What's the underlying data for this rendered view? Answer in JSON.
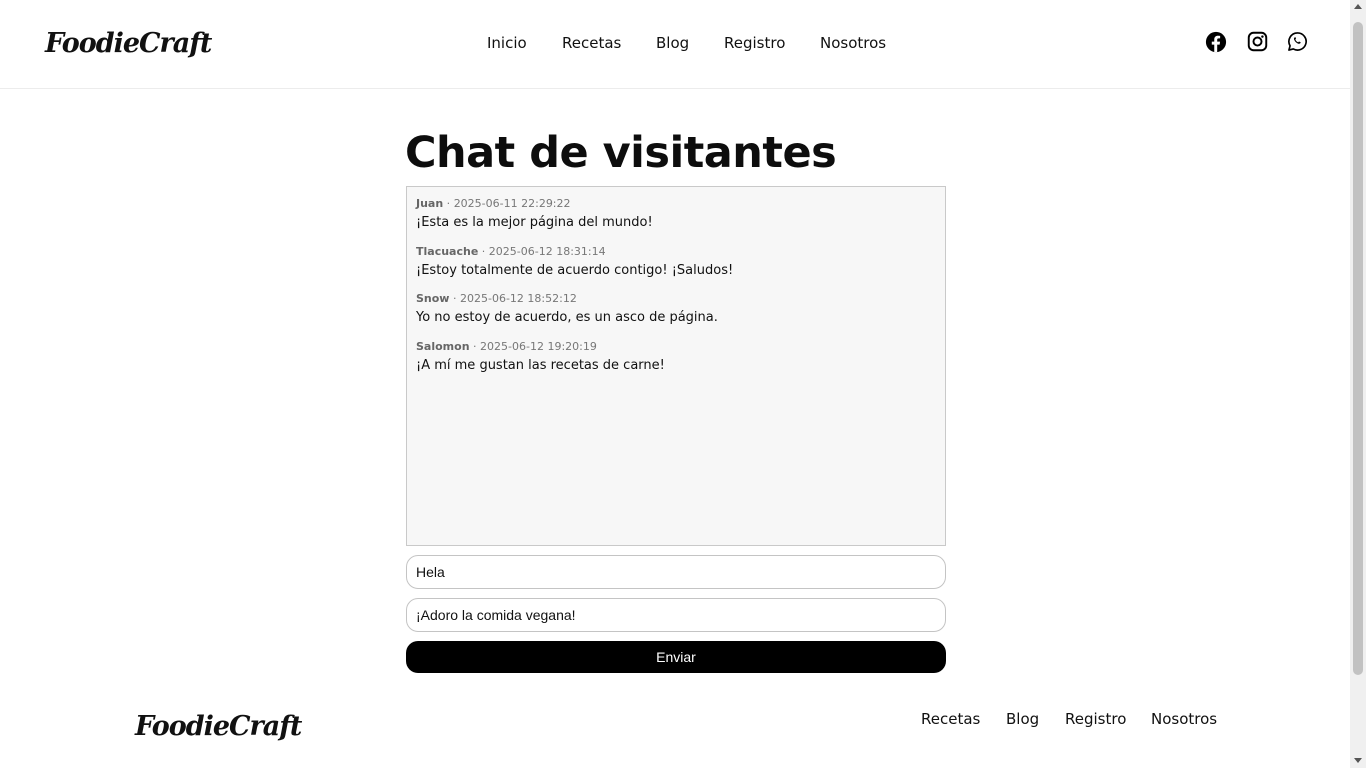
{
  "header": {
    "logo": "FoodieCraft",
    "nav": [
      "Inicio",
      "Recetas",
      "Blog",
      "Registro",
      "Nosotros"
    ],
    "social": [
      "facebook-icon",
      "instagram-icon",
      "whatsapp-icon"
    ]
  },
  "main": {
    "title": "Chat de visitantes",
    "messages": [
      {
        "author": "Juan",
        "time": "2025-06-11 22:29:22",
        "text": "¡Esta es la mejor página del mundo!"
      },
      {
        "author": "Tlacuache",
        "time": "2025-06-12 18:31:14",
        "text": "¡Estoy totalmente de acuerdo contigo! ¡Saludos!"
      },
      {
        "author": "Snow",
        "time": "2025-06-12 18:52:12",
        "text": "Yo no estoy de acuerdo, es un asco de página."
      },
      {
        "author": "Salomon",
        "time": "2025-06-12 19:20:19",
        "text": "¡A mí me gustan las recetas de carne!"
      }
    ],
    "meta_separator": " · ",
    "name_value": "Hela",
    "message_value": "¡Adoro la comida vegana!",
    "send_label": "Enviar"
  },
  "footer": {
    "logo": "FoodieCraft",
    "nav": [
      "Recetas",
      "Blog",
      "Registro",
      "Nosotros"
    ]
  },
  "colors": {
    "text": "#111111",
    "chat_bg": "#f7f7f7",
    "button_bg": "#000000",
    "button_text": "#ffffff"
  }
}
